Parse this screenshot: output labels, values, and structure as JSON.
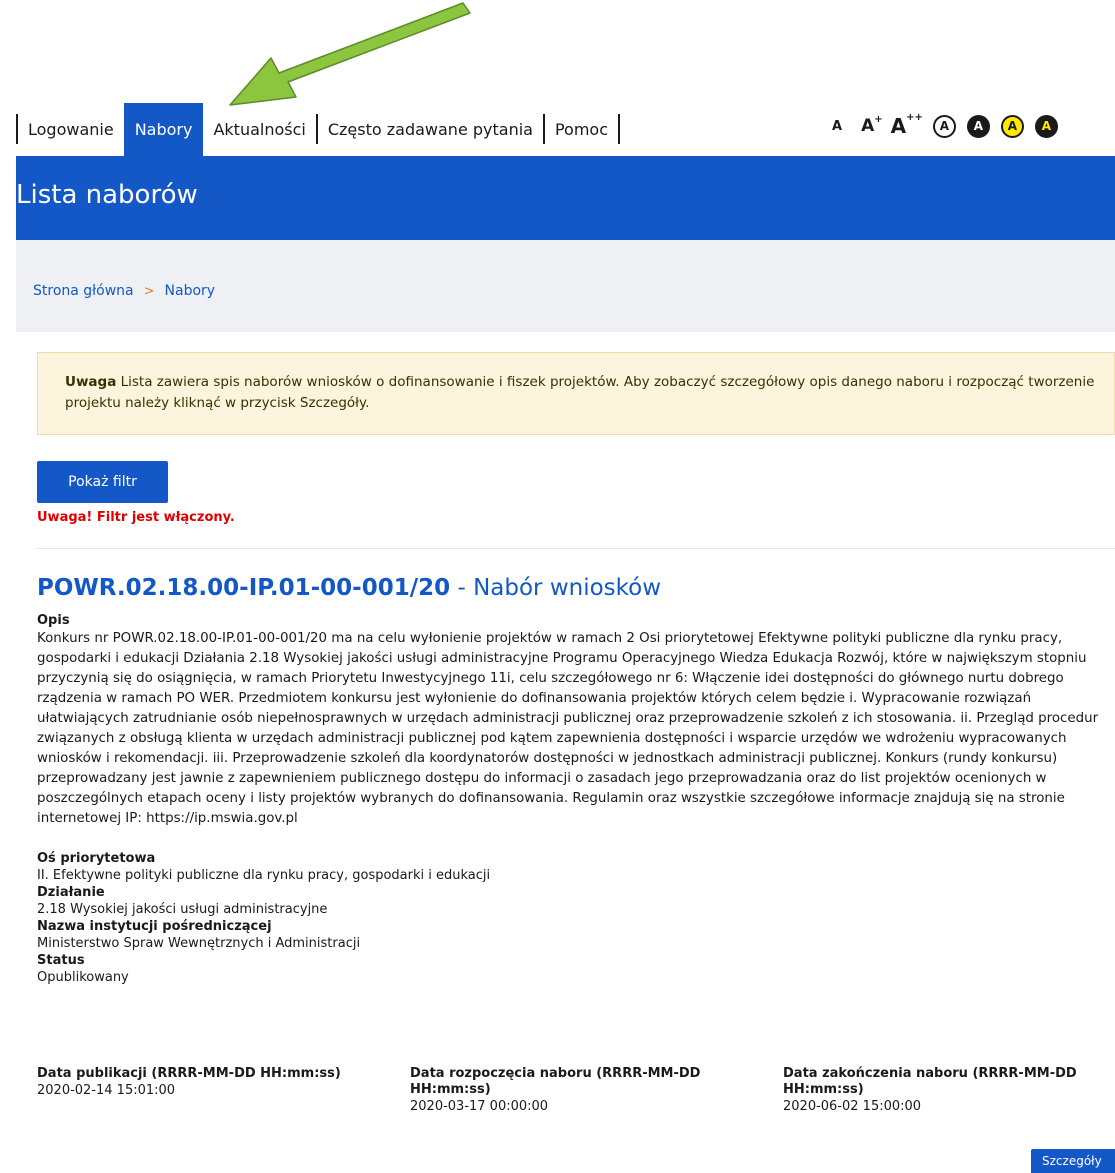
{
  "nav": {
    "items": [
      {
        "label": "Logowanie",
        "active": false
      },
      {
        "label": "Nabory",
        "active": true
      },
      {
        "label": "Aktualności",
        "active": false
      },
      {
        "label": "Często zadawane pytania",
        "active": false
      },
      {
        "label": "Pomoc",
        "active": false
      }
    ]
  },
  "accessibility": {
    "font_small": "A",
    "font_medium": "A",
    "font_medium_sup": "+",
    "font_large": "A",
    "font_large_sup": "++",
    "contrast_letter": "A",
    "contrast_modes": [
      "default",
      "black-white",
      "yellow-black",
      "black-yellow"
    ]
  },
  "colors": {
    "primary": "#1458c8",
    "breadcrumb_bg": "#eef0f3",
    "warning_bg": "#fcf4dc",
    "alert_red": "#e00000",
    "arrow_green": "#8cc63f"
  },
  "page": {
    "title": "Lista naborów"
  },
  "breadcrumb": {
    "home": "Strona główna",
    "separator": ">",
    "current": "Nabory"
  },
  "notice": {
    "bold": "Uwaga",
    "text": " Lista zawiera spis naborów wniosków o dofinansowanie i fiszek projektów. Aby zobaczyć szczegółowy opis danego naboru i rozpocząć tworzenie projektu należy kliknąć w przycisk Szczegóły."
  },
  "filter": {
    "button_label": "Pokaż filtr",
    "status": "Uwaga! Filtr jest włączony."
  },
  "record": {
    "code": "POWR.02.18.00-IP.01-00-001/20",
    "dash": " - ",
    "kind": "Nabór wniosków",
    "description_label": "Opis",
    "description": "Konkurs nr POWR.02.18.00-IP.01-00-001/20 ma na celu wyłonienie projektów w ramach 2 Osi priorytetowej Efektywne polityki publiczne dla rynku pracy, gospodarki i edukacji Działania 2.18 Wysokiej jakości usługi administracyjne Programu Operacyjnego Wiedza Edukacja Rozwój, które w największym stopniu przyczynią się do osiągnięcia, w ramach Priorytetu Inwestycyjnego 11i, celu szczegółowego nr 6: Włączenie idei dostępności do głównego nurtu dobrego rządzenia w ramach PO WER. Przedmiotem konkursu jest wyłonienie do dofinansowania projektów których celem będzie i. Wypracowanie rozwiązań ułatwiających zatrudnianie osób niepełnosprawnych w urzędach administracji publicznej oraz przeprowadzenie szkoleń z ich stosowania. ii. Przegląd procedur związanych z obsługą klienta w urzędach administracji publicznej pod kątem zapewnienia dostępności i wsparcie urzędów we wdrożeniu wypracowanych wniosków i rekomendacji. iii. Przeprowadzenie szkoleń dla koordynatorów dostępności w jednostkach administracji publicznej. Konkurs (rundy konkursu) przeprowadzany jest jawnie z zapewnieniem publicznego dostępu do informacji o zasadach jego przeprowadzania oraz do list projektów ocenionych w poszczególnych etapach oceny i listy projektów wybranych do dofinansowania. Regulamin oraz wszystkie szczegółowe informacje znajdują się na stronie internetowej IP: https://ip.mswia.gov.pl",
    "axis_label": "Oś priorytetowa",
    "axis_value": "II. Efektywne polityki publiczne dla rynku pracy, gospodarki i edukacji",
    "action_label": "Działanie",
    "action_value": "2.18 Wysokiej jakości usługi administracyjne",
    "institution_label": "Nazwa instytucji pośredniczącej",
    "institution_value": "Ministerstwo Spraw Wewnętrznych i Administracji",
    "status_label": "Status",
    "status_value": "Opublikowany",
    "publication_label": "Data publikacji (RRRR-MM-DD HH:mm:ss)",
    "publication_value": "2020-02-14 15:01:00",
    "start_label": "Data rozpoczęcia naboru (RRRR-MM-DD HH:mm:ss)",
    "start_value": "2020-03-17 00:00:00",
    "end_label": "Data zakończenia naboru (RRRR-MM-DD HH:mm:ss)",
    "end_value": "2020-06-02 15:00:00",
    "details_button": "Szczegóły"
  }
}
